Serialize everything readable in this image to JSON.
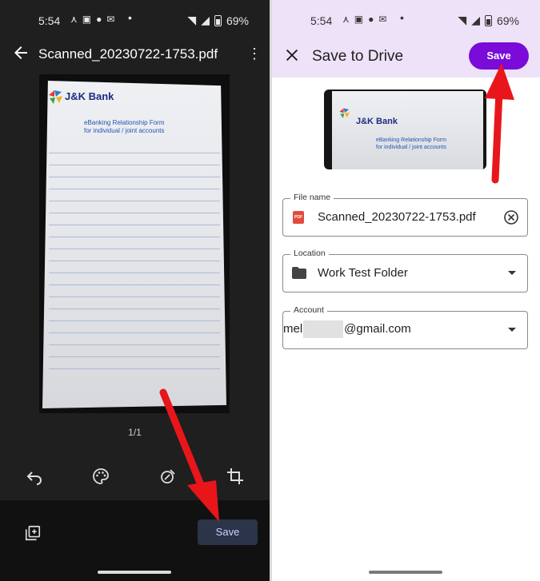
{
  "left_panel": {
    "status": {
      "time": "5:54",
      "battery": "69%"
    },
    "title": "Scanned_20230722-1753.pdf",
    "document": {
      "bank_name": "J&K Bank",
      "form_title_line1": "eBanking Relationship Form",
      "form_title_line2": "for individual / joint accounts"
    },
    "page_indicator": "1/1",
    "save_label": "Save"
  },
  "right_panel": {
    "status": {
      "time": "5:54",
      "battery": "69%"
    },
    "title": "Save to Drive",
    "save_label": "Save",
    "thumbnail": {
      "bank_name": "J&K Bank",
      "form_title_line1": "eBanking Relationship Form",
      "form_title_line2": "for individual / joint accounts"
    },
    "file_name": {
      "label": "File name",
      "value": "Scanned_20230722-1753.pdf",
      "icon_text": "PDF"
    },
    "location": {
      "label": "Location",
      "value": "Work Test Folder"
    },
    "account": {
      "label": "Account",
      "value_prefix": "mel",
      "value_suffix": "@gmail.com"
    }
  },
  "colors": {
    "accent": "#7a0bd8",
    "header_bg": "#ede2f7",
    "dark_bg": "#1f1f1f",
    "arrow": "#e8161b"
  }
}
